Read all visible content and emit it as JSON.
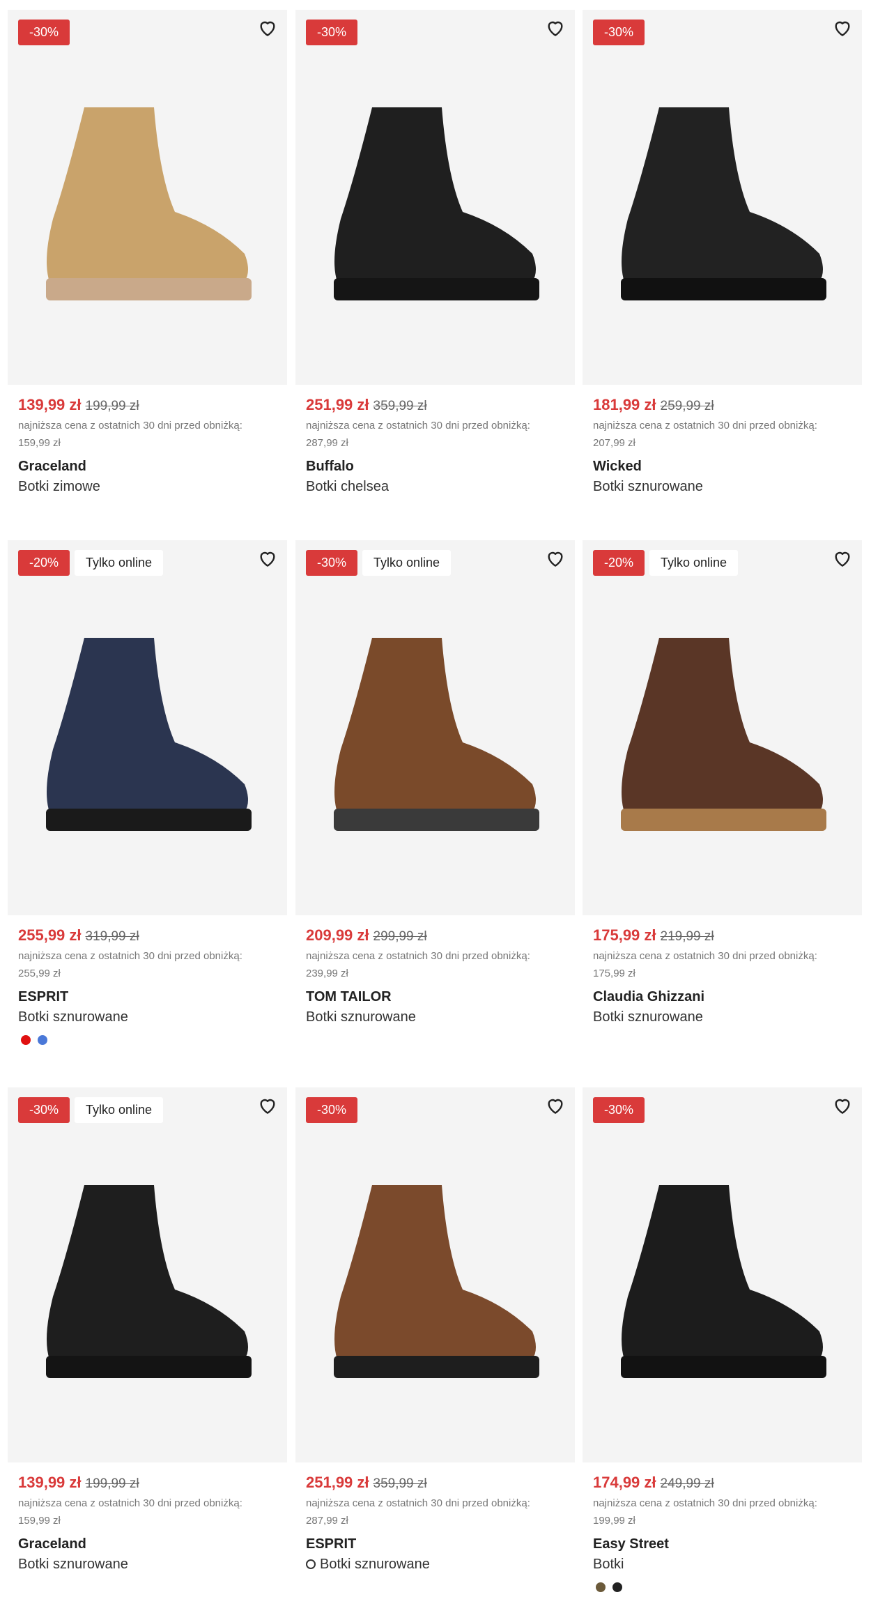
{
  "products": [
    {
      "discount": "-30%",
      "online": "",
      "price": "139,99 zł",
      "old_price": "199,99 zł",
      "lowest_label": "najniższa cena z ostatnich 30 dni przed obniżką:",
      "lowest_price": "159,99 zł",
      "brand": "Graceland",
      "type": "Botki zimowe",
      "boot_color": "#c9a36b",
      "sole_color": "#c9a98a"
    },
    {
      "discount": "-30%",
      "online": "",
      "price": "251,99 zł",
      "old_price": "359,99 zł",
      "lowest_label": "najniższa cena z ostatnich 30 dni przed obniżką:",
      "lowest_price": "287,99 zł",
      "brand": "Buffalo",
      "type": "Botki chelsea",
      "boot_color": "#1f1f1f",
      "sole_color": "#151515"
    },
    {
      "discount": "-30%",
      "online": "",
      "price": "181,99 zł",
      "old_price": "259,99 zł",
      "lowest_label": "najniższa cena z ostatnich 30 dni przed obniżką:",
      "lowest_price": "207,99 zł",
      "brand": "Wicked",
      "type": "Botki sznurowane",
      "boot_color": "#222222",
      "sole_color": "#111111"
    },
    {
      "discount": "-20%",
      "online": "Tylko online",
      "price": "255,99 zł",
      "old_price": "319,99 zł",
      "lowest_label": "najniższa cena z ostatnich 30 dni przed obniżką:",
      "lowest_price": "255,99 zł",
      "brand": "ESPRIT",
      "type": "Botki sznurowane",
      "boot_color": "#2b3550",
      "sole_color": "#1a1a1a",
      "swatches": [
        "#e01010",
        "#4a78d8"
      ]
    },
    {
      "discount": "-30%",
      "online": "Tylko online",
      "price": "209,99 zł",
      "old_price": "299,99 zł",
      "lowest_label": "najniższa cena z ostatnich 30 dni przed obniżką:",
      "lowest_price": "239,99 zł",
      "brand": "TOM TAILOR",
      "type": "Botki sznurowane",
      "boot_color": "#7a4a2a",
      "sole_color": "#3a3a3a"
    },
    {
      "discount": "-20%",
      "online": "Tylko online",
      "price": "175,99 zł",
      "old_price": "219,99 zł",
      "lowest_label": "najniższa cena z ostatnich 30 dni przed obniżką:",
      "lowest_price": "175,99 zł",
      "brand": "Claudia Ghizzani",
      "type": "Botki sznurowane",
      "boot_color": "#5a3626",
      "sole_color": "#a87a4a"
    },
    {
      "discount": "-30%",
      "online": "Tylko online",
      "price": "139,99 zł",
      "old_price": "199,99 zł",
      "lowest_label": "najniższa cena z ostatnich 30 dni przed obniżką:",
      "lowest_price": "159,99 zł",
      "brand": "Graceland",
      "type": "Botki sznurowane",
      "boot_color": "#1e1e1e",
      "sole_color": "#141414"
    },
    {
      "discount": "-30%",
      "online": "",
      "price": "251,99 zł",
      "old_price": "359,99 zł",
      "lowest_label": "najniższa cena z ostatnich 30 dni przed obniżką:",
      "lowest_price": "287,99 zł",
      "brand": "ESPRIT",
      "type": "Botki sznurowane",
      "boot_color": "#7b4a2c",
      "sole_color": "#1e1e1e",
      "eco": true
    },
    {
      "discount": "-30%",
      "online": "",
      "price": "174,99 zł",
      "old_price": "249,99 zł",
      "lowest_label": "najniższa cena z ostatnich 30 dni przed obniżką:",
      "lowest_price": "199,99 zł",
      "brand": "Easy Street",
      "type": "Botki",
      "boot_color": "#1c1c1c",
      "sole_color": "#121212",
      "swatches": [
        "#6b5a3a",
        "#222222"
      ]
    }
  ]
}
